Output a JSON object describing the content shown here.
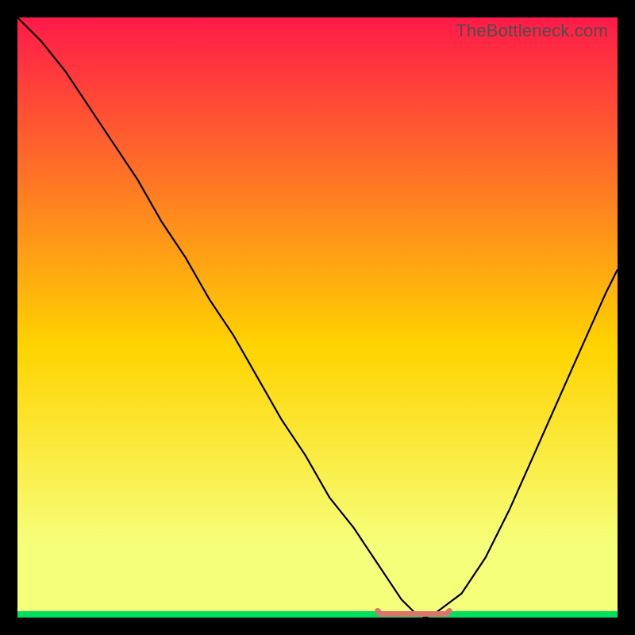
{
  "watermark": "TheBottleneck.com",
  "chart_data": {
    "type": "line",
    "title": "",
    "xlabel": "",
    "ylabel": "",
    "xlim": [
      0,
      100
    ],
    "ylim": [
      0,
      100
    ],
    "background_gradient": {
      "top_color": "#ff1a49",
      "mid_color": "#ffd400",
      "bottom_band_color": "#f6ff7a",
      "bottom_stripe_color": "#00e060"
    },
    "curve": {
      "name": "bottleneck-curve",
      "color": "#000000",
      "x": [
        0,
        4,
        8,
        12,
        16,
        20,
        24,
        28,
        32,
        36,
        40,
        44,
        48,
        52,
        56,
        60,
        62,
        64,
        66,
        68,
        70,
        74,
        78,
        82,
        86,
        90,
        94,
        98,
        100
      ],
      "y": [
        100,
        96,
        91,
        85,
        79,
        73,
        66,
        60,
        53,
        47,
        40,
        33,
        27,
        20,
        15,
        9,
        6,
        3,
        1,
        0,
        1,
        4,
        10,
        18,
        27,
        36,
        45,
        54,
        58
      ]
    },
    "flat_segment": {
      "name": "baseline-marker",
      "color": "#d9756a",
      "x_start": 60,
      "x_end": 72,
      "y": 0.6,
      "end_caps": true
    }
  }
}
